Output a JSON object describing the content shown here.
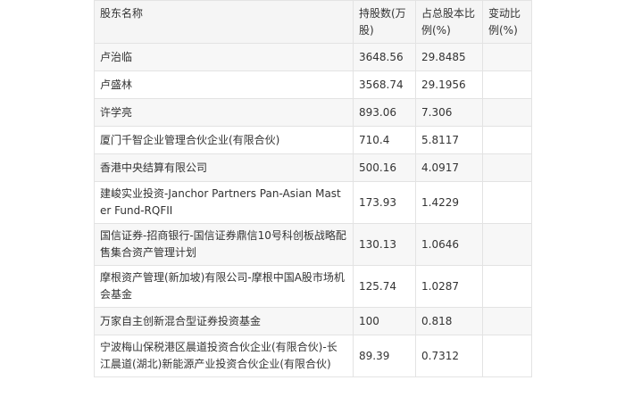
{
  "table": {
    "headers": [
      "股东名称",
      "持股数(万股)",
      "占总股本比例(%)",
      "变动比例(%)"
    ],
    "rows": [
      {
        "name": "卢治临",
        "shares": "3648.56",
        "pct": "29.8485",
        "change": ""
      },
      {
        "name": "卢盛林",
        "shares": "3568.74",
        "pct": "29.1956",
        "change": ""
      },
      {
        "name": "许学亮",
        "shares": "893.06",
        "pct": "7.306",
        "change": ""
      },
      {
        "name": "厦门千智企业管理合伙企业(有限合伙)",
        "shares": "710.4",
        "pct": "5.8117",
        "change": ""
      },
      {
        "name": "香港中央结算有限公司",
        "shares": "500.16",
        "pct": "4.0917",
        "change": ""
      },
      {
        "name": "建峻实业投资-Janchor Partners Pan-Asian Master Fund-RQFII",
        "shares": "173.93",
        "pct": "1.4229",
        "change": ""
      },
      {
        "name": "国信证券-招商银行-国信证券鼎信10号科创板战略配售集合资产管理计划",
        "shares": "130.13",
        "pct": "1.0646",
        "change": ""
      },
      {
        "name": "摩根资产管理(新加坡)有限公司-摩根中国A股市场机会基金",
        "shares": "125.74",
        "pct": "1.0287",
        "change": ""
      },
      {
        "name": "万家自主创新混合型证券投资基金",
        "shares": "100",
        "pct": "0.818",
        "change": ""
      },
      {
        "name": "宁波梅山保税港区晨道投资合伙企业(有限合伙)-长江晨道(湖北)新能源产业投资合伙企业(有限合伙)",
        "shares": "89.39",
        "pct": "0.7312",
        "change": ""
      }
    ]
  }
}
